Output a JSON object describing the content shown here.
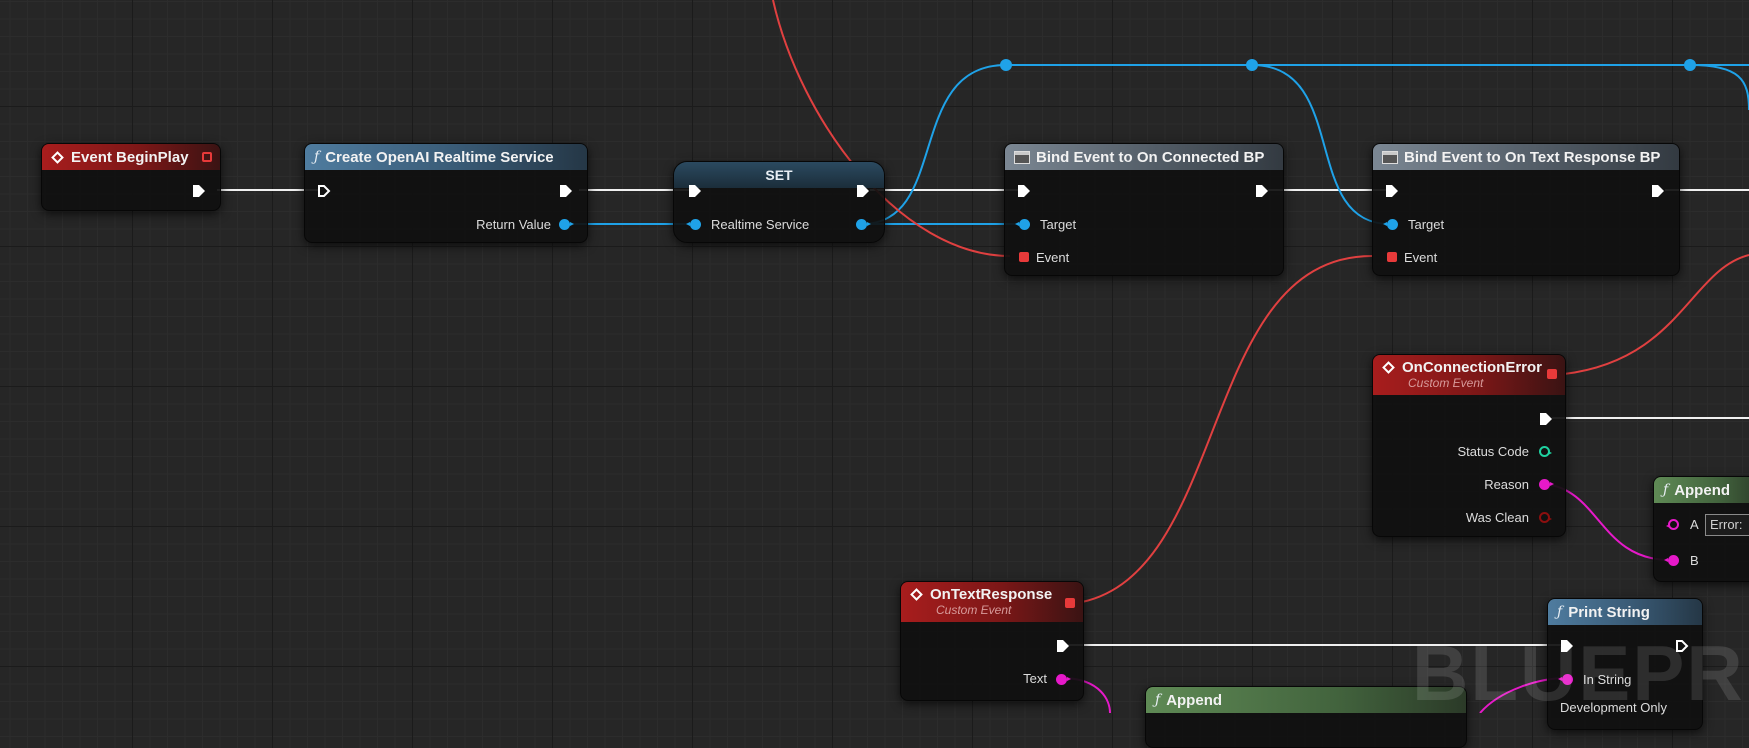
{
  "colors": {
    "exec": "#ffffff",
    "object": "#1fa2e8",
    "delegate": "#e83a3a",
    "string": "#e619c9",
    "integer": "#1fd1a0",
    "boolean": "#8c0f0f"
  },
  "nodes": {
    "begin_play": {
      "title": "Event BeginPlay"
    },
    "create_service": {
      "title": "Create OpenAI Realtime Service",
      "return_value": "Return Value"
    },
    "set_node": {
      "title": "SET",
      "realtime_service": "Realtime Service"
    },
    "bind_connected": {
      "title": "Bind Event to On Connected BP",
      "target": "Target",
      "event": "Event"
    },
    "bind_text": {
      "title": "Bind Event to On Text Response BP",
      "target": "Target",
      "event": "Event"
    },
    "on_connection_error": {
      "title": "OnConnectionError",
      "subtitle": "Custom Event",
      "status_code": "Status Code",
      "reason": "Reason",
      "was_clean": "Was Clean"
    },
    "append_error": {
      "title": "Append",
      "a": "A",
      "a_value": "Error:",
      "b": "B"
    },
    "on_text_response": {
      "title": "OnTextResponse",
      "subtitle": "Custom Event",
      "text": "Text"
    },
    "print_string": {
      "title": "Print String",
      "in_string": "In String",
      "development_only": "Development Only"
    },
    "append_text": {
      "title": "Append"
    }
  },
  "icons": {
    "event": "event-diamond-icon",
    "function": "function-f-icon",
    "bind": "bind-event-icon",
    "exec": "exec-arrow-icon",
    "delegate": "delegate-square-icon"
  },
  "watermark": "BLUEPRINT"
}
